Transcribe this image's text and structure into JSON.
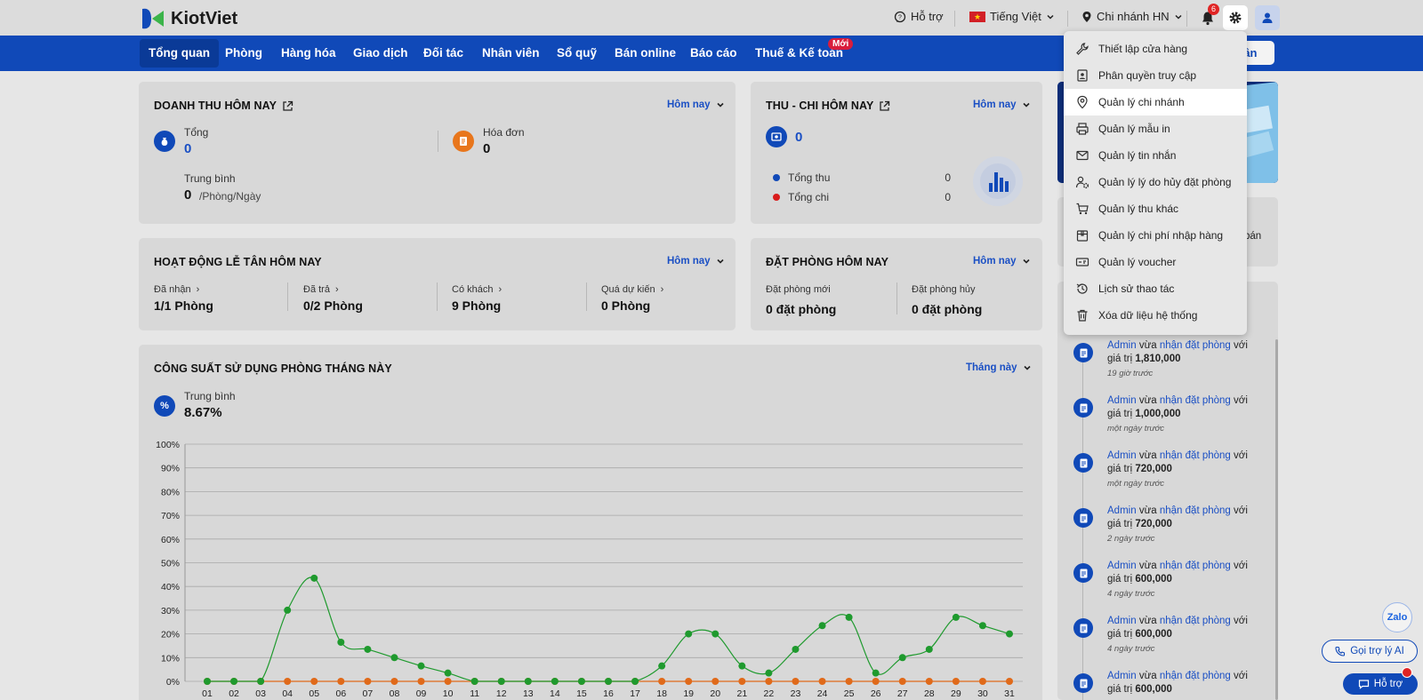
{
  "header": {
    "logo_text": "KiotViet",
    "support_label": "Hỗ trợ",
    "language_label": "Tiếng Việt",
    "branch_label": "Chi nhánh HN",
    "notification_count": "6"
  },
  "nav": {
    "items": [
      "Tổng quan",
      "Phòng",
      "Hàng hóa",
      "Giao dịch",
      "Đối tác",
      "Nhân viên",
      "Sổ quỹ",
      "Bán online",
      "Báo cáo",
      "Thuế & Kế toán"
    ],
    "new_badge": "Mới",
    "reception_button": "tân"
  },
  "revenue": {
    "title": "DOANH THU HÔM NAY",
    "period": "Hôm nay",
    "total_label": "Tổng",
    "total_value": "0",
    "invoice_label": "Hóa đơn",
    "invoice_value": "0",
    "avg_label": "Trung bình",
    "avg_value": "0",
    "avg_unit": "/Phòng/Ngày"
  },
  "cashflow": {
    "title": "THU - CHI HÔM NAY",
    "period": "Hôm nay",
    "value": "0",
    "income_label": "Tổng thu",
    "income_value": "0",
    "expense_label": "Tổng chi",
    "expense_value": "0"
  },
  "reception": {
    "title": "HOẠT ĐỘNG LỄ TÂN HÔM NAY",
    "period": "Hôm nay",
    "stats": [
      {
        "label": "Đã nhận",
        "value": "1/1 Phòng"
      },
      {
        "label": "Đã trả",
        "value": "0/2 Phòng"
      },
      {
        "label": "Có khách",
        "value": "9 Phòng"
      },
      {
        "label": "Quá dự kiến",
        "value": "0 Phòng"
      }
    ]
  },
  "booking": {
    "title": "ĐẶT PHÒNG HÔM NAY",
    "period": "Hôm nay",
    "new_label": "Đặt phòng mới",
    "new_value": "0 đặt phòng",
    "cancel_label": "Đặt phòng hủy",
    "cancel_value": "0 đặt phòng"
  },
  "occupancy": {
    "title": "CÔNG SUẤT SỬ DỤNG PHÒNG THÁNG NÀY",
    "period": "Tháng này",
    "avg_label": "Trung bình",
    "avg_value": "8.67%"
  },
  "chart_data": {
    "type": "line",
    "categories": [
      "01",
      "02",
      "03",
      "04",
      "05",
      "06",
      "07",
      "08",
      "09",
      "10",
      "11",
      "12",
      "13",
      "14",
      "15",
      "16",
      "17",
      "18",
      "19",
      "20",
      "21",
      "22",
      "23",
      "24",
      "25",
      "26",
      "27",
      "28",
      "29",
      "30",
      "31"
    ],
    "y_ticks": [
      "0%",
      "10%",
      "20%",
      "30%",
      "40%",
      "50%",
      "60%",
      "70%",
      "80%",
      "90%",
      "100%"
    ],
    "ylim": [
      0,
      100
    ],
    "grid": true,
    "series": [
      {
        "values": [
          0,
          0,
          0,
          30,
          43.5,
          16.5,
          13.5,
          10,
          6.5,
          3.5,
          0,
          0,
          0,
          0,
          0,
          0,
          0,
          6.5,
          20,
          20,
          6.5,
          3.5,
          13.5,
          23.5,
          27,
          3.5,
          10,
          13.5,
          27,
          23.5,
          20
        ],
        "color": "#1f9a2e"
      },
      {
        "values": [
          0,
          0,
          0,
          0,
          0,
          0,
          0,
          0,
          0,
          0,
          0,
          0,
          0,
          0,
          0,
          0,
          0,
          0,
          0,
          0,
          0,
          0,
          0,
          0,
          0,
          0,
          0,
          0,
          0,
          0,
          0
        ],
        "color": "#e06a1a"
      }
    ]
  },
  "settings_menu": {
    "items": [
      {
        "label": "Thiết lập cửa hàng",
        "icon": "wrench-icon"
      },
      {
        "label": "Phân quyền truy cập",
        "icon": "permission-icon"
      },
      {
        "label": "Quản lý chi nhánh",
        "icon": "location-icon"
      },
      {
        "label": "Quản lý mẫu in",
        "icon": "printer-icon"
      },
      {
        "label": "Quản lý tin nhắn",
        "icon": "mail-icon"
      },
      {
        "label": "Quản lý lý do hủy đặt phòng",
        "icon": "user-settings-icon"
      },
      {
        "label": "Quản lý thu khác",
        "icon": "cart-icon"
      },
      {
        "label": "Quản lý chi phí nhập hàng",
        "icon": "box-icon"
      },
      {
        "label": "Quản lý voucher",
        "icon": "voucher-icon"
      },
      {
        "label": "Lịch sử thao tác",
        "icon": "history-icon"
      },
      {
        "label": "Xóa dữ liệu hệ thống",
        "icon": "trash-icon"
      }
    ]
  },
  "side": {
    "partial_text": "bán"
  },
  "feed": {
    "items": [
      {
        "user": "Admin",
        "mid": "vừa",
        "action": "nhận đặt phòng",
        "tail": "với",
        "value_label": "giá trị",
        "value": "1,810,000",
        "time": "19 giờ trước"
      },
      {
        "user": "Admin",
        "mid": "vừa",
        "action": "nhận đặt phòng",
        "tail": "với",
        "value_label": "giá trị",
        "value": "1,000,000",
        "time": "một ngày trước"
      },
      {
        "user": "Admin",
        "mid": "vừa",
        "action": "nhận đặt phòng",
        "tail": "với",
        "value_label": "giá trị",
        "value": "720,000",
        "time": "một ngày trước"
      },
      {
        "user": "Admin",
        "mid": "vừa",
        "action": "nhận đặt phòng",
        "tail": "với",
        "value_label": "giá trị",
        "value": "720,000",
        "time": "2 ngày trước"
      },
      {
        "user": "Admin",
        "mid": "vừa",
        "action": "nhận đặt phòng",
        "tail": "với",
        "value_label": "giá trị",
        "value": "600,000",
        "time": "4 ngày trước"
      },
      {
        "user": "Admin",
        "mid": "vừa",
        "action": "nhận đặt phòng",
        "tail": "với",
        "value_label": "giá trị",
        "value": "600,000",
        "time": "4 ngày trước"
      },
      {
        "user": "Admin",
        "mid": "vừa",
        "action": "nhận đặt phòng",
        "tail": "với",
        "value_label": "giá trị",
        "value": "600,000",
        "time": ""
      }
    ]
  },
  "floating": {
    "zalo_label": "Zalo",
    "ai_label": "Gọi trợ lý AI",
    "support_label": "Hỗ trợ"
  }
}
